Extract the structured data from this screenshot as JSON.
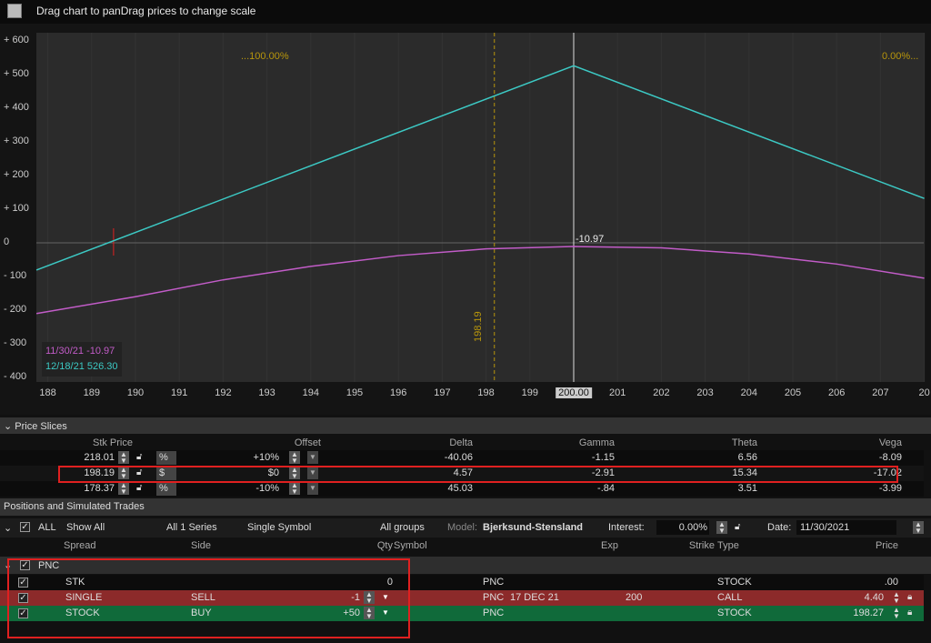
{
  "header": {
    "title": "Drag chart to panDrag prices to change scale",
    "icon": "chart-icon"
  },
  "chart_data": {
    "type": "line",
    "title": "",
    "xlabel": "",
    "ylabel": "",
    "xlim": [
      187.74,
      208.0
    ],
    "ylim": [
      -420,
      620
    ],
    "x_ticks": [
      "188",
      "189",
      "190",
      "191",
      "192",
      "193",
      "194",
      "195",
      "196",
      "197",
      "198",
      "199",
      "200.00",
      "201",
      "202",
      "203",
      "204",
      "205",
      "206",
      "207",
      "20"
    ],
    "y_ticks": [
      "+ 600",
      "+ 500",
      "+ 400",
      "+ 300",
      "+ 200",
      "+ 100",
      "0",
      "- 100",
      "- 200",
      "- 300",
      "- 400"
    ],
    "series": [
      {
        "name": "12/18/21",
        "color": "#3cc9c4",
        "x": [
          187.74,
          200,
          208
        ],
        "y": [
          -81,
          526.3,
          132
        ]
      },
      {
        "name": "11/30/21",
        "color": "#c25cc8",
        "x": [
          187.74,
          190,
          192,
          194,
          196,
          198,
          200,
          202,
          204,
          206,
          208
        ],
        "y": [
          -210,
          -160,
          -110,
          -70,
          -38,
          -18,
          -10.97,
          -15,
          -33,
          -63,
          -105
        ]
      }
    ],
    "legend": [
      {
        "date": "11/30/21",
        "value": "-10.97",
        "color": "#c25cc8"
      },
      {
        "date": "12/18/21",
        "value": "526.30",
        "color": "#3cc9c4"
      }
    ],
    "annotations": {
      "left_pct": "...100.00%",
      "right_pct": "0.00%...",
      "current_price": "198.19",
      "current_x": 198.19,
      "cursor_x": 200,
      "cursor_value": "-10.97",
      "marker_x": 189.5
    }
  },
  "price_slices": {
    "title": "Price Slices",
    "headers": {
      "stk": "Stk Price",
      "offset": "Offset",
      "delta": "Delta",
      "gamma": "Gamma",
      "theta": "Theta",
      "vega": "Vega"
    },
    "rows": [
      {
        "stk": "218.01",
        "unit": "%",
        "offset": "+10%",
        "delta": "-40.06",
        "gamma": "-1.15",
        "theta": "6.56",
        "vega": "-8.09"
      },
      {
        "stk": "198.19",
        "unit": "$",
        "offset": "$0",
        "delta": "4.57",
        "gamma": "-2.91",
        "theta": "15.34",
        "vega": "-17.02"
      },
      {
        "stk": "178.37",
        "unit": "%",
        "offset": "-10%",
        "delta": "45.03",
        "gamma": "-.84",
        "theta": "3.51",
        "vega": "-3.99"
      }
    ]
  },
  "positions": {
    "title": "Positions and Simulated Trades",
    "filters": {
      "all": "ALL",
      "show": "Show All",
      "series": "All 1 Series",
      "symbol": "Single Symbol",
      "groups": "All groups",
      "model_label": "Model:",
      "model": "Bjerksund-Stensland",
      "interest_label": "Interest:",
      "interest": "0.00%",
      "date_label": "Date:",
      "date": "11/30/2021"
    },
    "headers": {
      "spread": "Spread",
      "side": "Side",
      "qty": "Qty",
      "symbol": "Symbol",
      "exp": "Exp",
      "strike": "Strike",
      "type": "Type",
      "price": "Price"
    },
    "group": "PNC",
    "rows": [
      {
        "spread": "STK",
        "side": "",
        "qty": "0",
        "symbol": "PNC",
        "exp": "",
        "strike": "",
        "type": "STOCK",
        "price": ".00",
        "style": "plain"
      },
      {
        "spread": "SINGLE",
        "side": "SELL",
        "qty": "-1",
        "symbol": "PNC",
        "exp": "17 DEC 21",
        "strike": "200",
        "type": "CALL",
        "price": "4.40",
        "style": "sell"
      },
      {
        "spread": "STOCK",
        "side": "BUY",
        "qty": "+50",
        "symbol": "PNC",
        "exp": "",
        "strike": "",
        "type": "STOCK",
        "price": "198.27",
        "style": "buy"
      }
    ]
  }
}
